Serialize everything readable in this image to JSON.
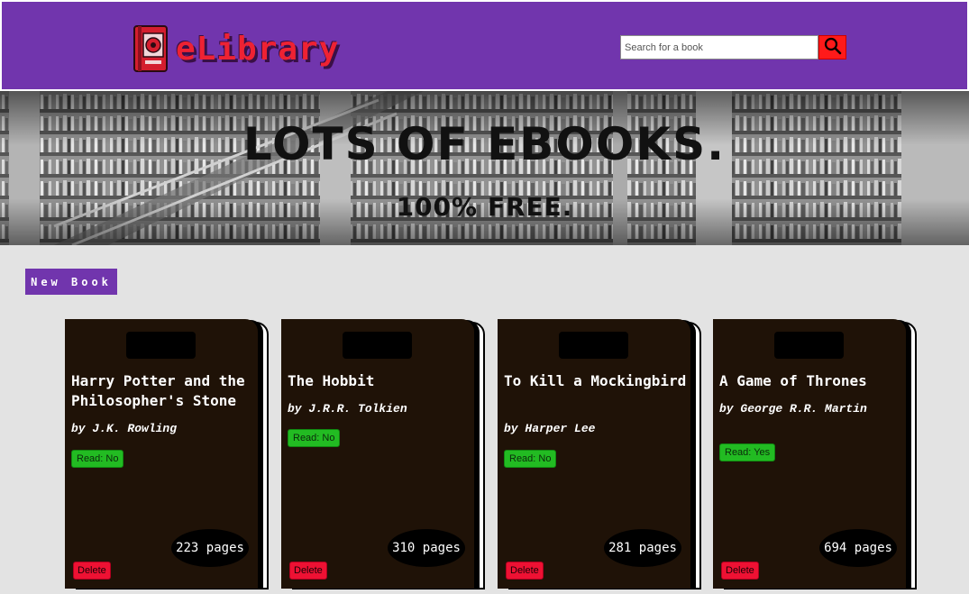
{
  "header": {
    "logo_text": "eLibrary",
    "search": {
      "placeholder": "Search for a book",
      "value": ""
    }
  },
  "hero": {
    "title": "LOTS OF EBOOKS.",
    "subtitle": "100% FREE."
  },
  "actions": {
    "new_book_label": "New Book"
  },
  "books": [
    {
      "title": "Harry Potter and the Philosopher's Stone",
      "author": "by J.K. Rowling",
      "read": "Read: No",
      "pages": "223 pages",
      "delete": "Delete"
    },
    {
      "title": "The Hobbit",
      "author": "by J.R.R. Tolkien",
      "read": "Read: No",
      "pages": "310 pages",
      "delete": "Delete"
    },
    {
      "title": "To Kill a Mockingbird",
      "author": "by Harper Lee",
      "read": "Read: No",
      "pages": "281 pages",
      "delete": "Delete"
    },
    {
      "title": "A Game of Thrones",
      "author": "by George R.R. Martin",
      "read": "Read: Yes",
      "pages": "694 pages",
      "delete": "Delete"
    }
  ],
  "colors": {
    "brand": "#7135ad",
    "logo": "#ee2233",
    "search_button": "#ff1a1a",
    "read_badge": "#22bb22",
    "delete_button": "#ee1133",
    "card_cover": "#1f1207"
  },
  "icons": {
    "logo": "book-icon",
    "search": "search-icon"
  }
}
